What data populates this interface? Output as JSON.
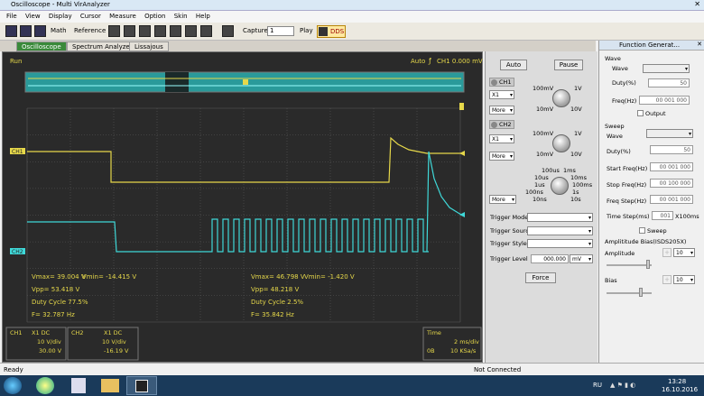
{
  "window": {
    "title": "Oscilloscope - Multi VirAnalyzer"
  },
  "menu": [
    "File",
    "View",
    "Display",
    "Cursor",
    "Measure",
    "Option",
    "Skin",
    "Help"
  ],
  "toolbar": {
    "math": "Math",
    "reference": "Reference",
    "capture": "Capture",
    "capture_count": "1",
    "play": "Play",
    "dds": "DDS"
  },
  "tabs": [
    "Oscilloscope",
    "Spectrum Analyzer",
    "Lissajous"
  ],
  "scope": {
    "run_state": "Run",
    "trigger_mode": "Auto",
    "trigger_info": "CH1 0.000 mV",
    "ch1_tag": "CH1",
    "ch2_tag": "CH2",
    "ch1_meas": {
      "vmax": "Vmax= 39.004 V",
      "vmin": "Vmin= -14.415 V",
      "vpp": "Vpp= 53.418 V",
      "duty": "Duty Cycle 77.5%",
      "freq": "F= 32.787 Hz"
    },
    "ch2_meas": {
      "vmax": "Vmax= 46.798 V",
      "vmin": "Vmin= -1.420 V",
      "vpp": "Vpp= 48.218 V",
      "duty": "Duty Cycle 2.5%",
      "freq": "F= 35.842 Hz"
    },
    "ch1_info": {
      "name": "CH1",
      "coupling": "X1  DC",
      "vdiv": "10 V/div",
      "offset": "30.00 V"
    },
    "ch2_info": {
      "name": "CH2",
      "coupling": "X1  DC",
      "vdiv": "10 V/div",
      "offset": "-16.19 V"
    },
    "time_info": {
      "label": "Time",
      "tdiv": "2 ms/div",
      "pos": "0B",
      "rate": "10 KSa/s"
    },
    "colors": {
      "ch1": "#e6d84a",
      "ch2": "#3fd8d8",
      "grid": "#5a5a5a",
      "bg": "#2a2a2a"
    }
  },
  "controls": {
    "auto": "Auto",
    "pause": "Pause",
    "ch1": "CH1",
    "ch2": "CH2",
    "probe1": "X1",
    "probe2": "X1",
    "more": "More",
    "volt_labels": [
      "100mV",
      "1V",
      "10mV",
      "10V"
    ],
    "time_labels": [
      "100us",
      "1ms",
      "10us",
      "10ms",
      "1us",
      "100ms",
      "100ns",
      "1s",
      "10ns",
      "10s"
    ],
    "trigger_mode": "Trigger Mode",
    "trigger_source": "Trigger Source",
    "trigger_style": "Trigger Style",
    "trigger_level": "Trigger Level",
    "trigger_level_value": "000.000",
    "trigger_level_unit": "mV",
    "force": "Force"
  },
  "fg": {
    "title": "Function Generat...",
    "wave_section": "Wave",
    "wave": "Wave",
    "duty": "Duty(%)",
    "duty_val": "50",
    "freq": "Freq(Hz)",
    "freq_val": "00 001 000",
    "output": "Output",
    "sweep_section": "Sweep",
    "sweep_wave": "Wave",
    "sweep_duty": "Duty(%)",
    "sweep_duty_val": "50",
    "start_freq": "Start Freq(Hz)",
    "start_freq_val": "00 001 000",
    "stop_freq": "Stop Freq(Hz)",
    "stop_freq_val": "00 100 000",
    "step_freq": "Freq Step(Hz)",
    "step_freq_val": "00 001 000",
    "time_step": "Time Step(ms)",
    "time_step_val": "001",
    "time_step_unit": "X100ms",
    "sweep": "Sweep",
    "amp_bias": "Amplititude Bias(ISDS205X)",
    "amplitude": "Amplitude",
    "amp_val": "10",
    "bias": "Bias",
    "bias_val": "10"
  },
  "status": {
    "left": "Ready",
    "right": "Not Connected"
  },
  "taskbar": {
    "lang": "RU",
    "time": "13:28",
    "date": "16.10.2016"
  }
}
